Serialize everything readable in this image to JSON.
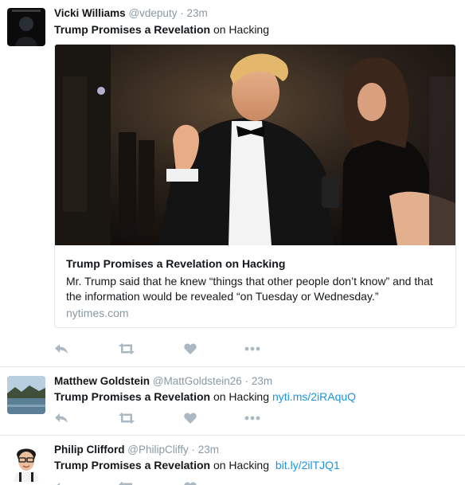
{
  "tweets": [
    {
      "fullname": "Vicki Williams",
      "handle": "@vdeputy",
      "dot": "·",
      "time": "23m",
      "text_bold": "Trump Promises a Revelation",
      "text_rest": " on Hacking",
      "card": {
        "title": "Trump Promises a Revelation on Hacking",
        "description": "Mr. Trump said that he knew “things that other people don’t know” and that the information would be revealed “on Tuesday or Wednesday.”",
        "domain": "nytimes.com"
      }
    },
    {
      "fullname": "Matthew Goldstein",
      "handle": "@MattGoldstein26",
      "dot": "·",
      "time": "23m",
      "text_bold": "Trump Promises a Revelation",
      "text_rest": " on Hacking",
      "link": "nyti.ms/2iRAquQ"
    },
    {
      "fullname": "Philip Clifford",
      "handle": "@PhilipCliffy",
      "dot": "·",
      "time": "23m",
      "text_bold": "Trump Promises a Revelation",
      "text_rest": " on Hacking",
      "link": "bit.ly/2ilTJQ1"
    }
  ],
  "icons": [
    "reply-icon",
    "retweet-icon",
    "like-icon",
    "more-icon"
  ],
  "colors": {
    "link": "#1b95e0",
    "muted": "#8899a6",
    "action_icon": "#aab8c2",
    "border": "#e1e8ed"
  }
}
